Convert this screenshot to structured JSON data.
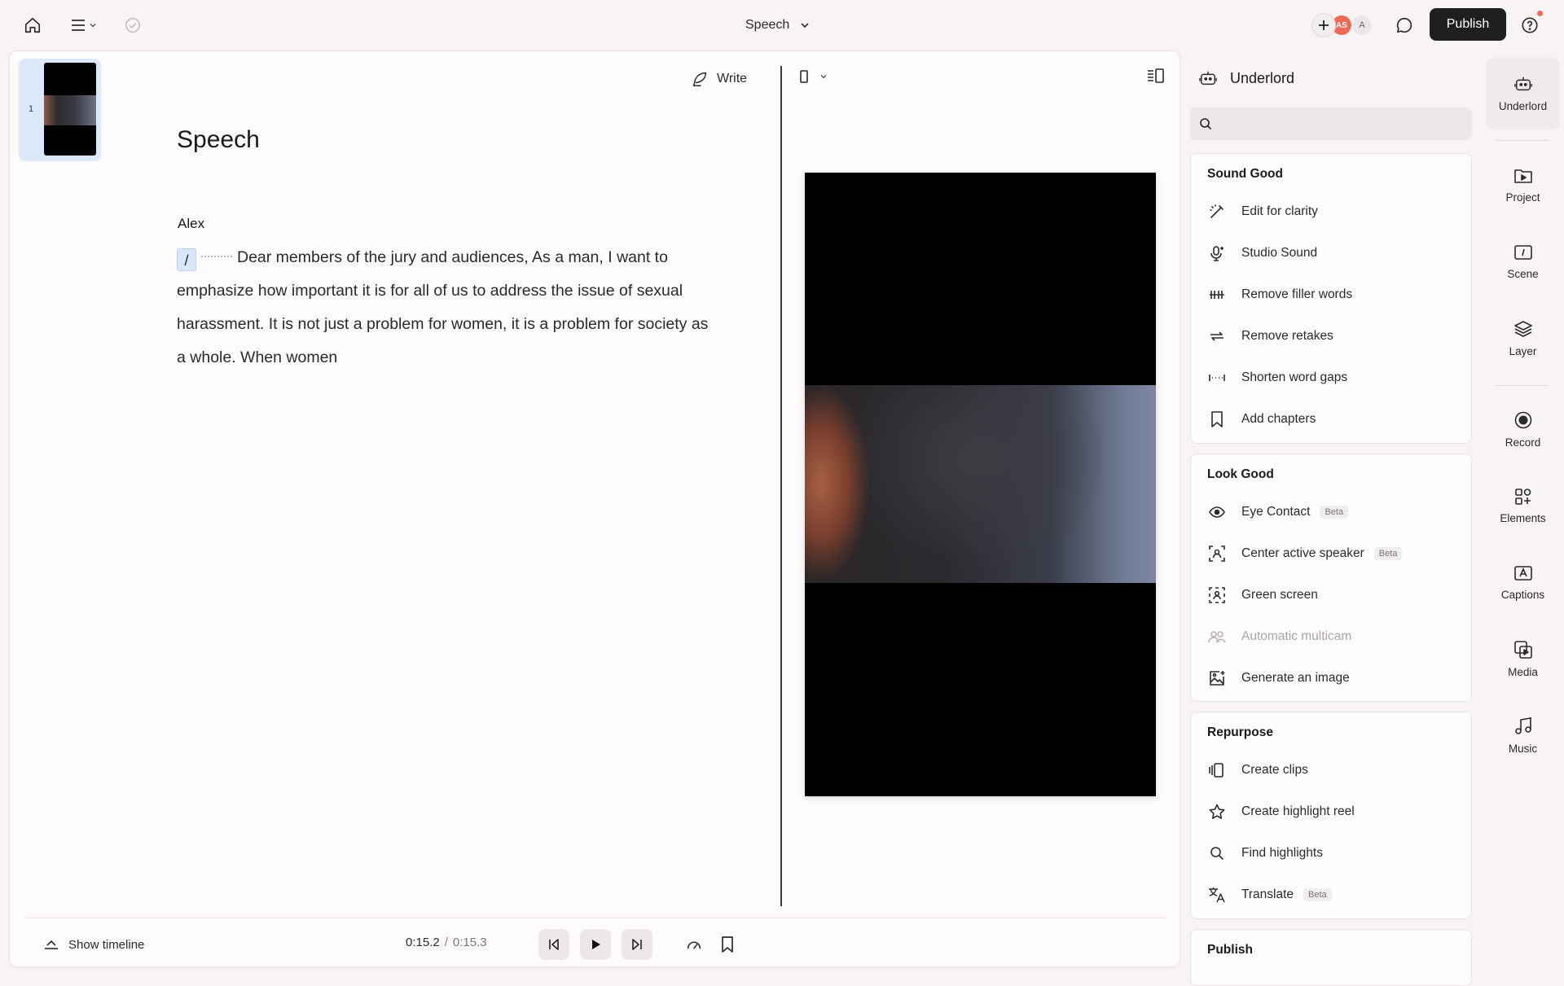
{
  "app": {
    "project_title": "Speech",
    "collaborators": [
      "AS",
      "A"
    ],
    "publish_label": "Publish"
  },
  "editor": {
    "scene_number": "1",
    "write_label": "Write",
    "doc_title": "Speech",
    "speaker": "Alex",
    "slash_chip": "/",
    "transcript": "Dear members of the jury and audiences, As a man, I want to emphasize how important it is for all of us to address the issue of sexual harassment. It is not just a problem for women, it is a problem for society as a whole. When women"
  },
  "playback": {
    "show_timeline_label": "Show timeline",
    "current_time": "0:15.2",
    "separator": "/",
    "duration": "0:15.3"
  },
  "underlord": {
    "title": "Underlord",
    "search_placeholder": "",
    "sections": [
      {
        "title": "Sound Good",
        "items": [
          {
            "label": "Edit for clarity",
            "icon": "wand-icon"
          },
          {
            "label": "Studio Sound",
            "icon": "mic-sparkle-icon"
          },
          {
            "label": "Remove filler words",
            "icon": "strikethrough-icon"
          },
          {
            "label": "Remove retakes",
            "icon": "repeat-icon"
          },
          {
            "label": "Shorten word gaps",
            "icon": "gap-icon"
          },
          {
            "label": "Add chapters",
            "icon": "bookmark-icon"
          }
        ]
      },
      {
        "title": "Look Good",
        "items": [
          {
            "label": "Eye Contact",
            "icon": "eye-icon",
            "badge": "Beta"
          },
          {
            "label": "Center active speaker",
            "icon": "focus-person-icon",
            "badge": "Beta"
          },
          {
            "label": "Green screen",
            "icon": "green-screen-icon"
          },
          {
            "label": "Automatic multicam",
            "icon": "people-icon",
            "disabled": true
          },
          {
            "label": "Generate an image",
            "icon": "image-sparkle-icon"
          }
        ]
      },
      {
        "title": "Repurpose",
        "items": [
          {
            "label": "Create clips",
            "icon": "clips-icon"
          },
          {
            "label": "Create highlight reel",
            "icon": "star-icon"
          },
          {
            "label": "Find highlights",
            "icon": "search-icon"
          },
          {
            "label": "Translate",
            "icon": "translate-icon",
            "badge": "Beta"
          }
        ]
      },
      {
        "title": "Publish",
        "items": []
      }
    ]
  },
  "rail": [
    {
      "label": "Underlord",
      "icon": "robot-icon",
      "active": true
    },
    {
      "label": "Project",
      "icon": "project-icon"
    },
    {
      "label": "Scene",
      "icon": "scene-icon"
    },
    {
      "label": "Layer",
      "icon": "layers-icon"
    },
    {
      "label": "Record",
      "icon": "record-icon"
    },
    {
      "label": "Elements",
      "icon": "elements-icon"
    },
    {
      "label": "Captions",
      "icon": "captions-icon"
    },
    {
      "label": "Media",
      "icon": "media-icon"
    },
    {
      "label": "Music",
      "icon": "music-icon"
    }
  ],
  "colors": {
    "background": "#f8f4f3",
    "accent_dark": "#1f1f1f",
    "avatar_accent": "#ef6a55",
    "selection_blue": "#dce9fb"
  }
}
